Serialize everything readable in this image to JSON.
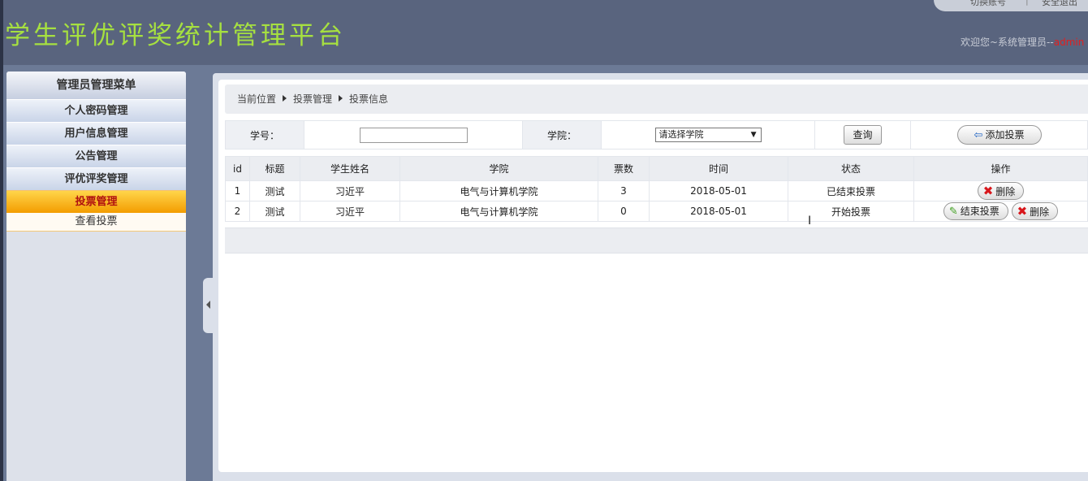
{
  "header": {
    "title": "学生评优评奖统计管理平台",
    "top_tab": [
      "切换账号",
      "|",
      "安全退出"
    ],
    "welcome_text": "欢迎您~系统管理员--",
    "welcome_user": "admin"
  },
  "sidebar": {
    "title": "管理员管理菜单",
    "items": [
      {
        "label": "个人密码管理"
      },
      {
        "label": "用户信息管理"
      },
      {
        "label": "公告管理"
      },
      {
        "label": "评优评奖管理"
      },
      {
        "label": "投票管理"
      }
    ],
    "active_index": 4,
    "sub_items": [
      {
        "label": "查看投票"
      }
    ]
  },
  "breadcrumb": [
    "当前位置",
    "投票管理",
    "投票信息"
  ],
  "search": {
    "student_no_label": "学号：",
    "student_no_value": "",
    "college_label": "学院：",
    "college_selected": "请选择学院",
    "query_label": "查询",
    "add_label": "添加投票"
  },
  "table": {
    "columns": [
      "id",
      "标题",
      "学生姓名",
      "学院",
      "票数",
      "时间",
      "状态",
      "操作"
    ],
    "rows": [
      {
        "id": "1",
        "title": "测试",
        "name": "习近平",
        "college": "电气与计算机学院",
        "votes": "3",
        "time": "2018-05-01",
        "status": "已结束投票",
        "actions": [
          "删除"
        ]
      },
      {
        "id": "2",
        "title": "测试",
        "name": "习近平",
        "college": "电气与计算机学院",
        "votes": "0",
        "time": "2018-05-01",
        "status": "开始投票",
        "actions": [
          "结束投票",
          "删除"
        ]
      }
    ]
  },
  "colors": {
    "title_green": "#a6e040",
    "active_orange": "#f39c00",
    "header_bg": "#59647e"
  }
}
